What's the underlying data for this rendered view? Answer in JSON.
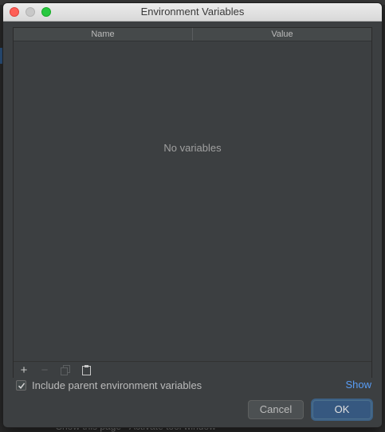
{
  "window": {
    "title": "Environment Variables"
  },
  "table": {
    "columns": [
      "Name",
      "Value"
    ],
    "empty_text": "No variables"
  },
  "toolbar": {
    "add_icon": "plus-icon",
    "remove_icon": "minus-icon",
    "copy_icon": "copy-icon",
    "paste_icon": "clipboard-icon",
    "add_glyph": "+",
    "remove_glyph": "−"
  },
  "options": {
    "include_parent_label": "Include parent environment variables",
    "include_parent_checked": true,
    "show_link": "Show"
  },
  "buttons": {
    "cancel": "Cancel",
    "ok": "OK"
  },
  "background": {
    "partial_text": "Show this page  ·  Activate tool window"
  },
  "colors": {
    "dialog_bg": "#3c3f41",
    "accent": "#365880",
    "link": "#589df6"
  }
}
